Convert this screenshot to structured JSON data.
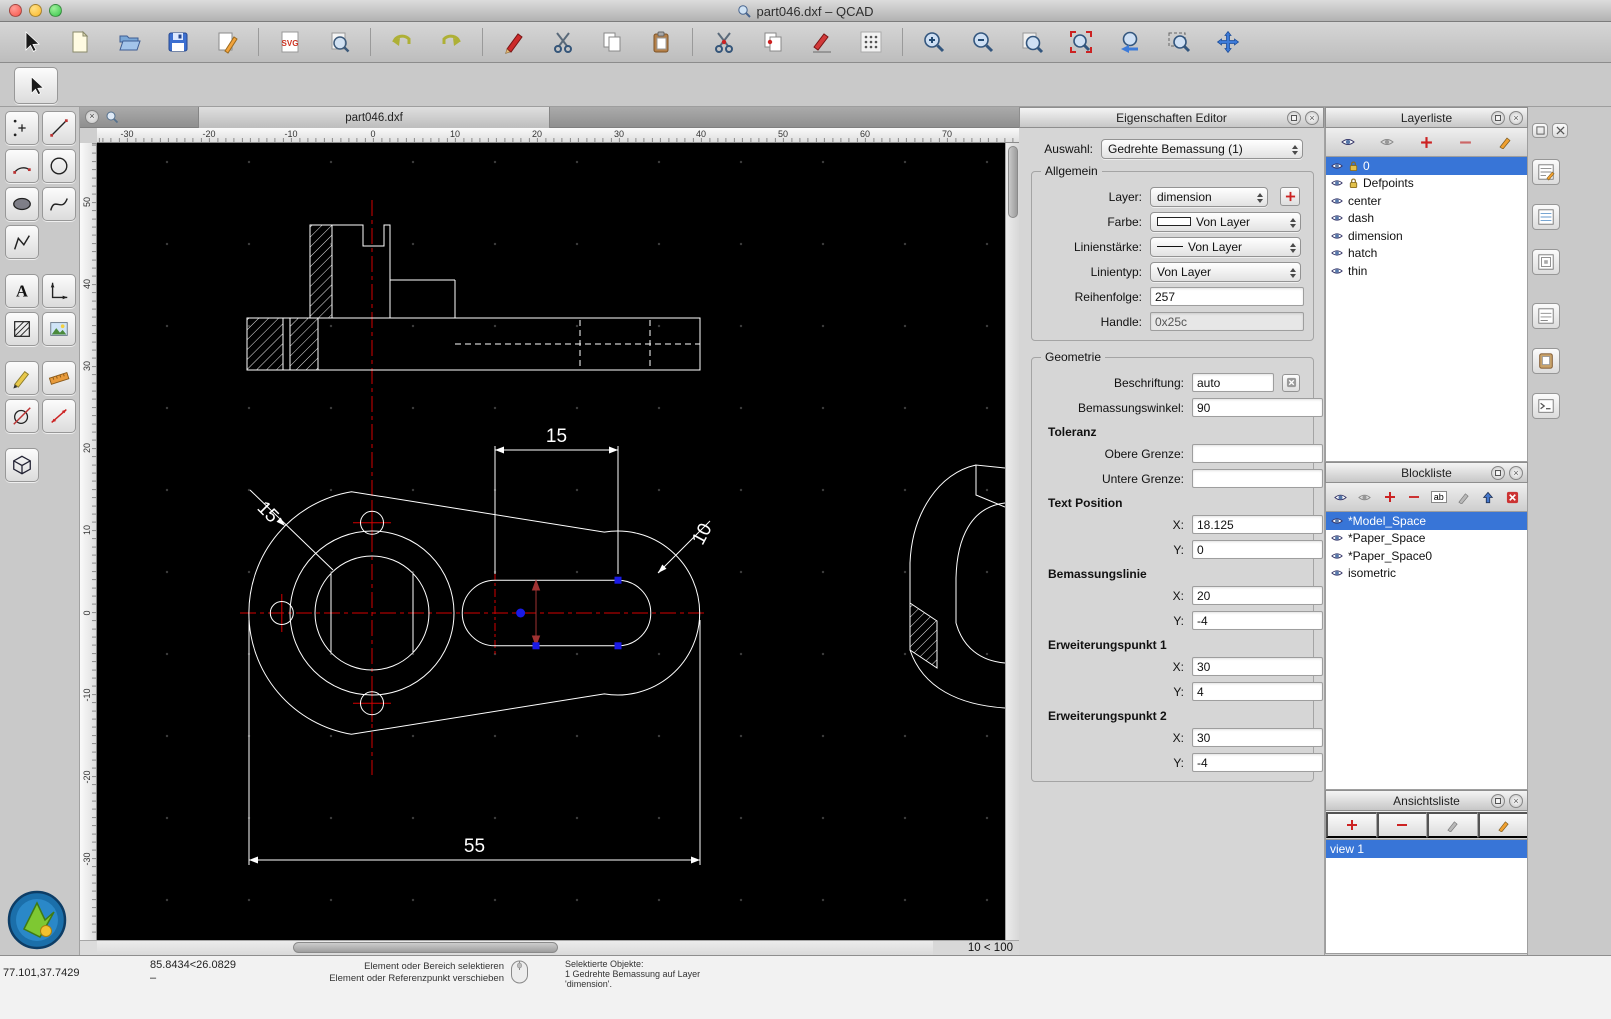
{
  "window": {
    "title": "part046.dxf – QCAD"
  },
  "tab": {
    "label": "part046.dxf",
    "close_glyph": "×"
  },
  "toolbar": {
    "svg_label": "SVG"
  },
  "tools": {
    "text_icon_label": "A"
  },
  "rulers": {
    "top": [
      "-30",
      "-20",
      "-10",
      "0",
      "10",
      "20",
      "30",
      "40",
      "50",
      "60",
      "70"
    ],
    "left": [
      "50",
      "40",
      "30",
      "20",
      "10",
      "0",
      "-10",
      "-20",
      "-30"
    ]
  },
  "drawing": {
    "dim_slot": "15",
    "dim_overall": "55",
    "dim_radius_left": "15",
    "dim_radius_tip": "10",
    "grid_status": "10 < 100"
  },
  "properties": {
    "title": "Eigenschaften Editor",
    "selection_label": "Auswahl:",
    "selection_value": "Gedrehte Bemassung (1)",
    "general": {
      "title": "Allgemein",
      "layer_label": "Layer:",
      "layer_value": "dimension",
      "color_label": "Farbe:",
      "color_value": "Von Layer",
      "lineweight_label": "Linienstärke:",
      "lineweight_value": "Von Layer",
      "linetype_label": "Linientyp:",
      "linetype_value": "Von Layer",
      "draworder_label": "Reihenfolge:",
      "draworder_value": "257",
      "handle_label": "Handle:",
      "handle_value": "0x25c"
    },
    "geometry": {
      "title": "Geometrie",
      "label_label": "Beschriftung:",
      "label_value": "auto",
      "angle_label": "Bemassungswinkel:",
      "angle_value": "90",
      "tolerance_title": "Toleranz",
      "upper_label": "Obere Grenze:",
      "upper_value": "",
      "lower_label": "Untere Grenze:",
      "lower_value": "",
      "textpos_title": "Text Position",
      "x_label": "X:",
      "y_label": "Y:",
      "textpos_x": "18.125",
      "textpos_y": "0",
      "dimline_title": "Bemassungslinie",
      "dimline_x": "20",
      "dimline_y": "-4",
      "ext1_title": "Erweiterungspunkt 1",
      "ext1_x": "30",
      "ext1_y": "4",
      "ext2_title": "Erweiterungspunkt 2",
      "ext2_x": "30",
      "ext2_y": "-4"
    }
  },
  "layers": {
    "title": "Layerliste",
    "items": [
      {
        "name": "0"
      },
      {
        "name": "Defpoints"
      },
      {
        "name": "center"
      },
      {
        "name": "dash"
      },
      {
        "name": "dimension"
      },
      {
        "name": "hatch"
      },
      {
        "name": "thin"
      }
    ]
  },
  "blocks": {
    "title": "Blockliste",
    "rename_label": "ab",
    "items": [
      {
        "name": "*Model_Space"
      },
      {
        "name": "*Paper_Space"
      },
      {
        "name": "*Paper_Space0"
      },
      {
        "name": "isometric"
      }
    ]
  },
  "views": {
    "title": "Ansichtsliste",
    "items": [
      {
        "name": "view 1"
      }
    ]
  },
  "statusbar": {
    "abs_coords": "77.101,37.7429",
    "rel_coords": "85.8434<26.0829",
    "rel_coords2": "–",
    "hint1": "Element oder Bereich selektieren",
    "hint2": "Element oder Referenzpunkt verschieben",
    "sel1": "Selektierte Objekte:",
    "sel2": "1 Gedrehte Bemassung auf Layer",
    "sel3": "'dimension'."
  }
}
